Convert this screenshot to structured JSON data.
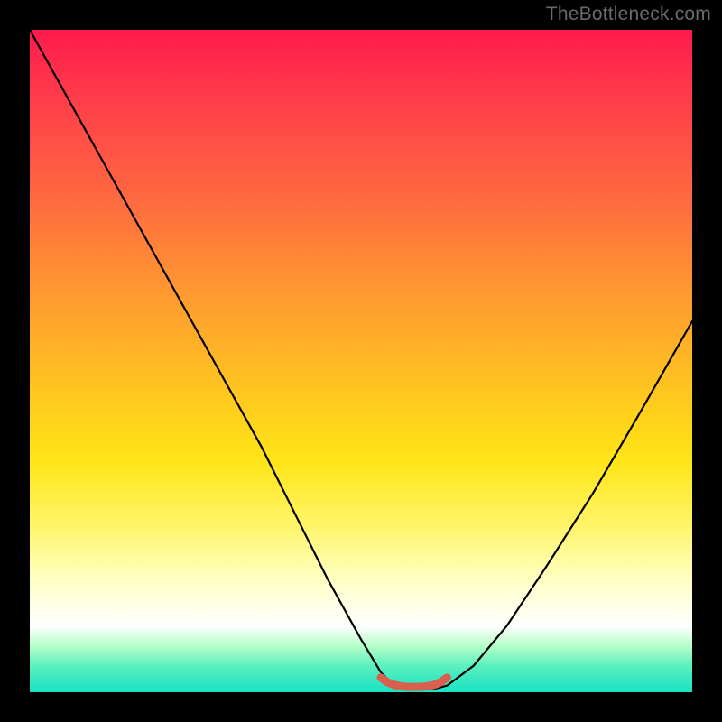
{
  "watermark": "TheBottleneck.com",
  "chart_data": {
    "type": "line",
    "title": "",
    "xlabel": "",
    "ylabel": "",
    "xlim": [
      0,
      100
    ],
    "ylim": [
      0,
      100
    ],
    "series": [
      {
        "name": "bottleneck-curve",
        "x": [
          0,
          5,
          10,
          15,
          20,
          25,
          30,
          35,
          40,
          45,
          50,
          53,
          55,
          57,
          59,
          61,
          63,
          67,
          72,
          78,
          85,
          92,
          100
        ],
        "y": [
          100,
          91,
          82,
          73,
          64,
          55,
          46,
          37,
          27,
          17,
          8,
          3,
          1,
          0.5,
          0.4,
          0.5,
          1,
          4,
          10,
          19,
          30,
          42,
          56
        ]
      },
      {
        "name": "optimal-band",
        "x": [
          53,
          54,
          55,
          56,
          57,
          58,
          59,
          60,
          61,
          62,
          63
        ],
        "y": [
          2.2,
          1.5,
          1.1,
          0.9,
          0.8,
          0.8,
          0.8,
          0.9,
          1.1,
          1.5,
          2.2
        ]
      }
    ],
    "colors": {
      "curve": "#000000",
      "band": "#d9604f",
      "gradient_top": "#ff1a4d",
      "gradient_mid": "#ffd020",
      "gradient_bottom": "#18e2c2"
    }
  }
}
